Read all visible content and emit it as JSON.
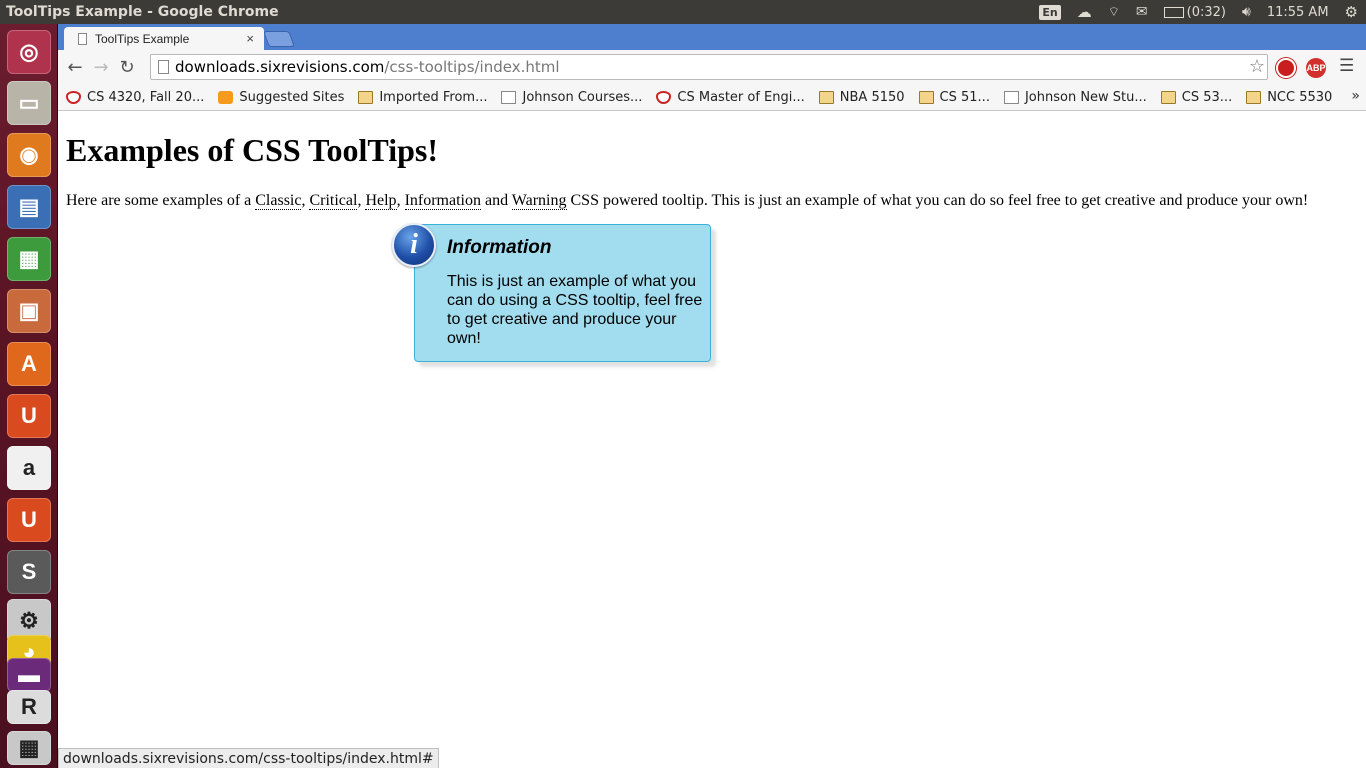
{
  "window": {
    "title": "ToolTips Example - Google Chrome"
  },
  "system": {
    "keyboard": "En",
    "battery": "(0:32)",
    "clock": "11:55 AM"
  },
  "launcher": {
    "icons": [
      "ubuntu-dash-icon",
      "file-manager-icon",
      "firefox-icon",
      "libreoffice-writer-icon",
      "libreoffice-calc-icon",
      "libreoffice-impress-icon",
      "software-center-icon",
      "ubuntu-one-icon",
      "amazon-icon",
      "ubuntu-one-music-icon",
      "sublime-text-icon",
      "system-settings-icon",
      "chrome-icon",
      "terminal-icon",
      "r-studio-icon",
      "workspace-switcher-icon"
    ]
  },
  "browser": {
    "tab": {
      "title": "ToolTips Example",
      "close": "×"
    },
    "url": {
      "host": "downloads.sixrevisions.com",
      "path": "/css-tooltips/index.html"
    },
    "bookmarks": [
      {
        "label": "CS 4320, Fall 20...",
        "icon": "shield-icon"
      },
      {
        "label": "Suggested Sites",
        "icon": "bulb-icon"
      },
      {
        "label": "Imported From...",
        "icon": "folder-icon"
      },
      {
        "label": "Johnson Courses...",
        "icon": "document-icon"
      },
      {
        "label": "CS Master of Engi...",
        "icon": "shield-icon"
      },
      {
        "label": "NBA 5150",
        "icon": "folder-icon"
      },
      {
        "label": "CS 51...",
        "icon": "folder-icon"
      },
      {
        "label": "Johnson New Stu...",
        "icon": "document-icon"
      },
      {
        "label": "CS 53...",
        "icon": "folder-icon"
      },
      {
        "label": "NCC 5530",
        "icon": "folder-icon"
      }
    ],
    "bookmarks_more": "»",
    "extensions": {
      "stop": "",
      "abp": "ABP"
    }
  },
  "page": {
    "heading": "Examples of CSS ToolTips!",
    "intro": {
      "prefix": "Here are some examples of a ",
      "classic": "Classic",
      "sep1": ", ",
      "critical": "Critical",
      "sep2": ", ",
      "help": "Help",
      "sep3": ", ",
      "information": "Information",
      "and": " and ",
      "warning": "Warning",
      "suffix": " CSS powered tooltip. This is just an example of what you can do so feel free to get creative and produce your own!"
    },
    "tooltip": {
      "icon_glyph": "i",
      "title": "Information",
      "body": "This is just an example of what you can do using a CSS tooltip, feel free to get creative and produce your own!"
    }
  },
  "statusbar": {
    "text": "downloads.sixrevisions.com/css-tooltips/index.html#"
  }
}
